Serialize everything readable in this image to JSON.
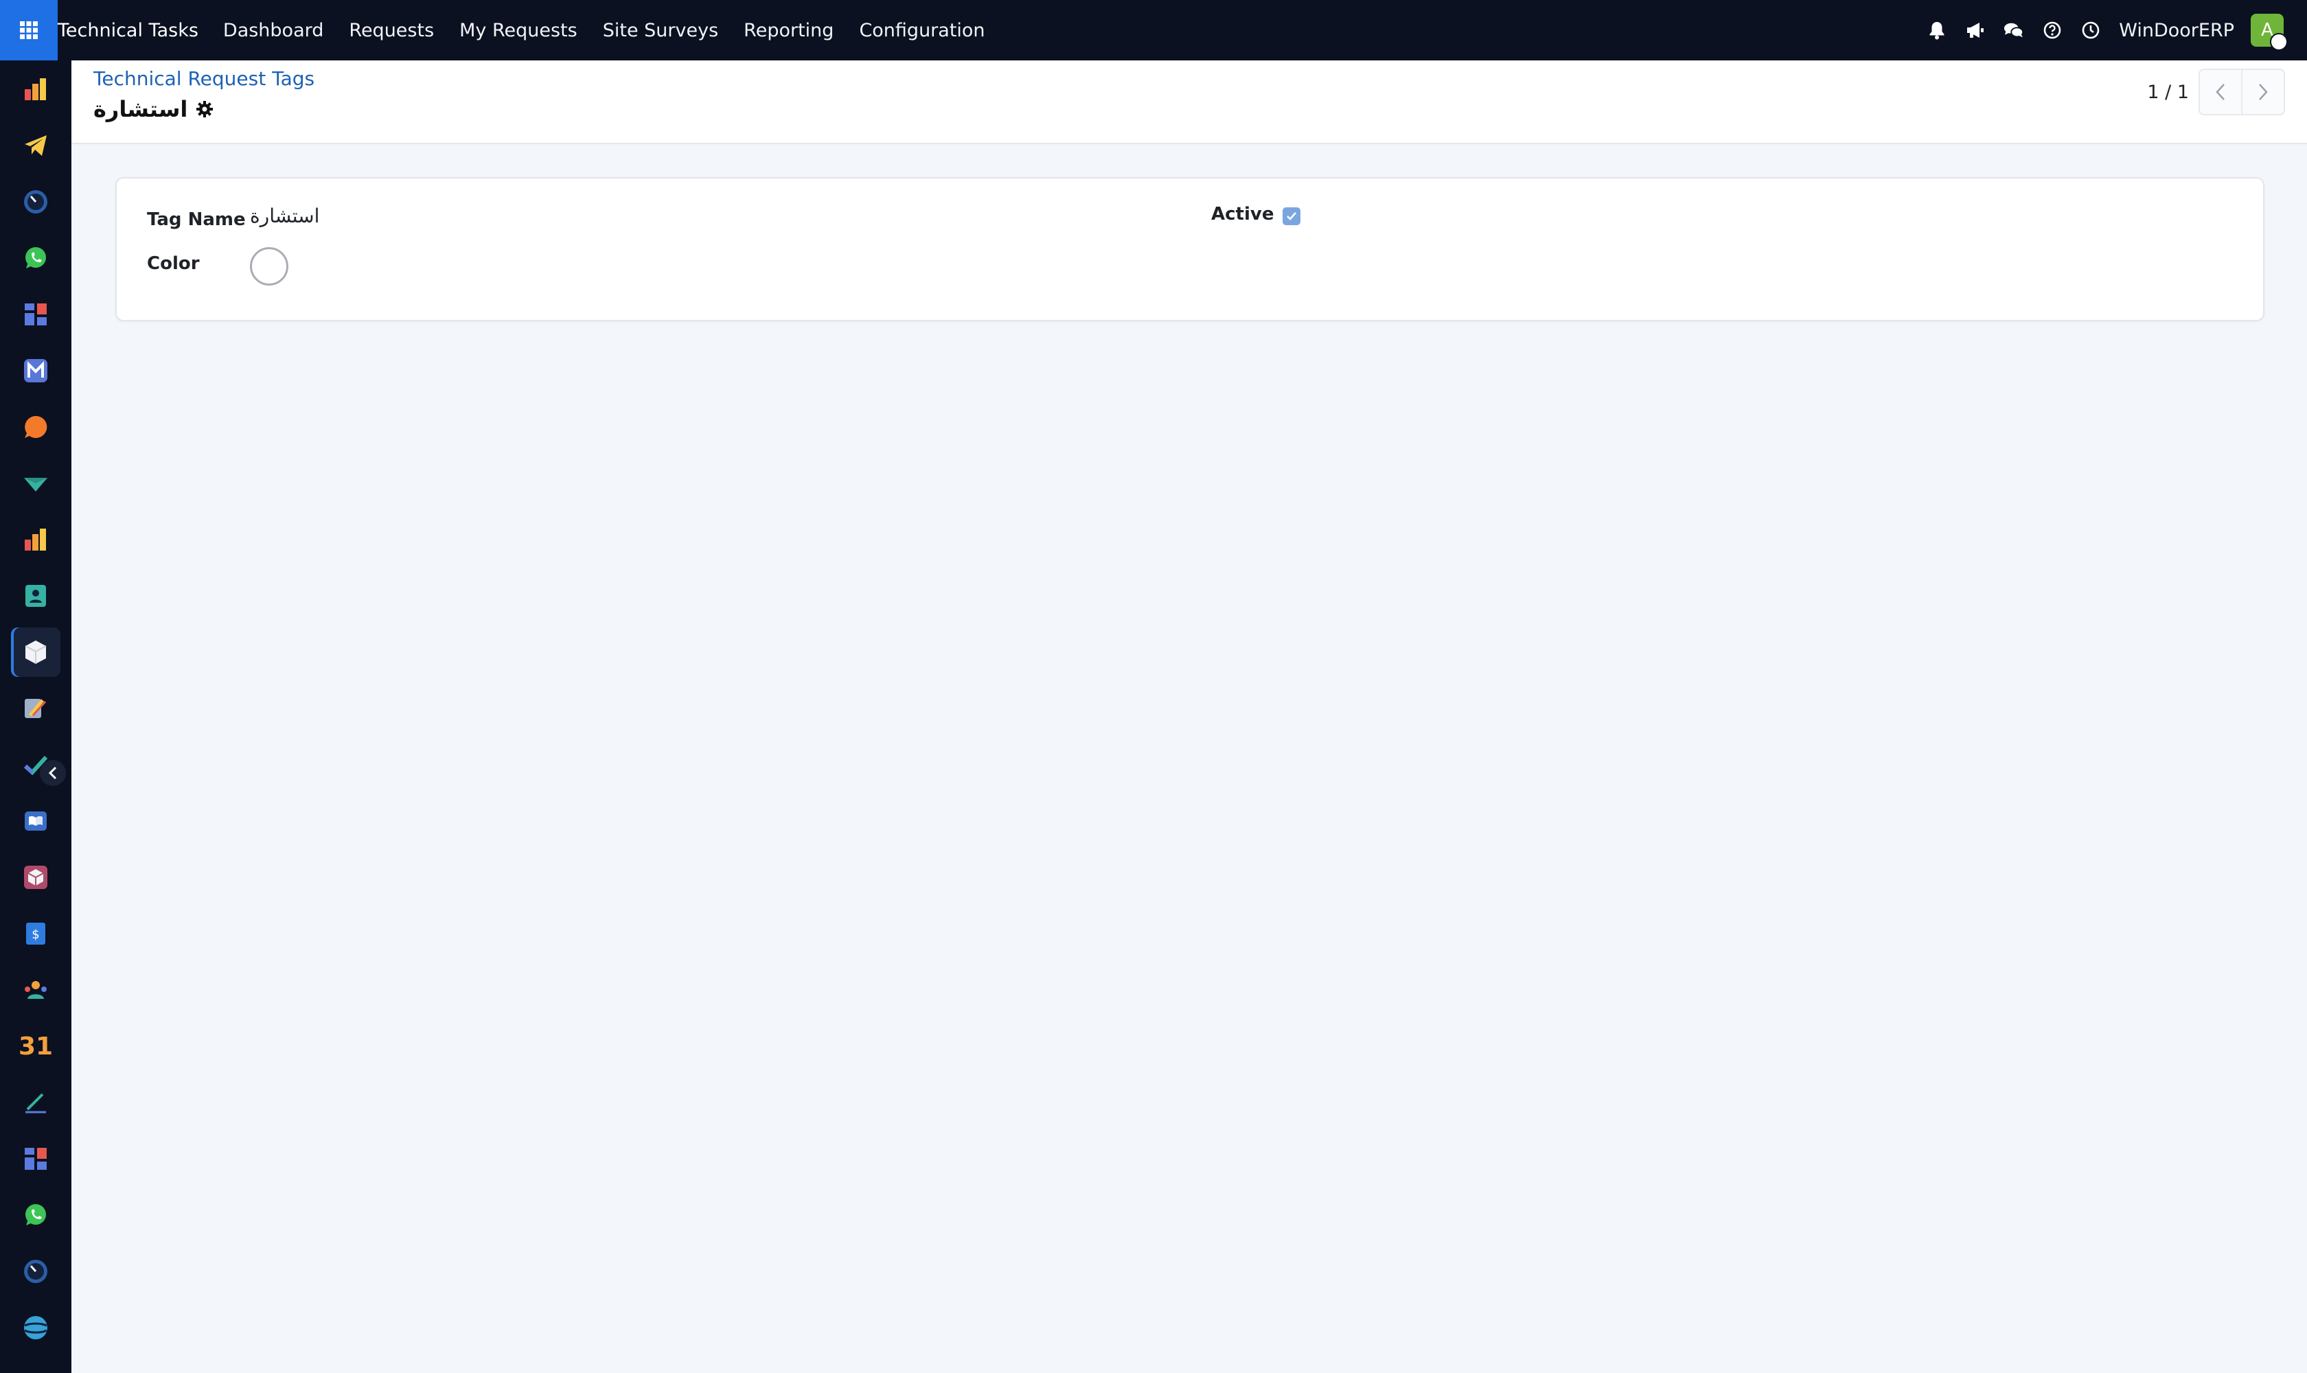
{
  "navbar": {
    "app_name": "Technical Tasks",
    "menu": [
      "Dashboard",
      "Requests",
      "My Requests",
      "Site Surveys",
      "Reporting",
      "Configuration"
    ],
    "company": "WinDoorERP",
    "avatar_initial": "A",
    "tray_icons": [
      "bell-icon",
      "megaphone-icon",
      "chat-icon",
      "help-icon",
      "clock-icon"
    ]
  },
  "sidebar": {
    "items": [
      "analytics-icon",
      "telegram-icon",
      "dashboard-gauge-icon",
      "whatsapp-icon",
      "blocks-icon",
      "mail-icon",
      "discuss-bubble-icon",
      "logistics-icon",
      "analytics-icon-2",
      "contacts-icon",
      "technical-tasks-icon",
      "spreadsheet-icon",
      "project-check-icon",
      "knowledge-icon",
      "inventory-box-icon",
      "invoicing-icon",
      "employees-icon",
      "calendar-icon",
      "sign-icon",
      "blocks-icon-2",
      "whatsapp-icon-2",
      "dashboard-gauge-icon-2",
      "website-icon"
    ],
    "calendar_number": "31"
  },
  "control_panel": {
    "breadcrumb": "Technical Request Tags",
    "record_title": "استشارة",
    "pager": "1 / 1"
  },
  "form": {
    "tag_name_label": "Tag Name",
    "tag_name_value": "استشارة",
    "color_label": "Color",
    "active_label": "Active",
    "active_checked": true
  },
  "colors": {
    "navbar_bg": "#0b1120",
    "accent": "#1f6fe5",
    "link": "#1d62b5",
    "avatar": "#6fb53a",
    "page_bg": "#f3f6fa"
  }
}
